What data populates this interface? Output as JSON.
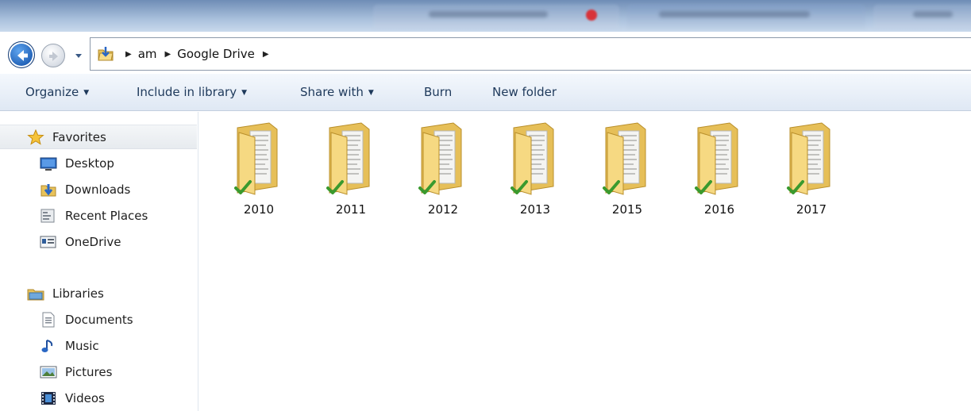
{
  "breadcrumb": {
    "items": [
      "am",
      "Google Drive"
    ]
  },
  "toolbar": {
    "organize_label": "Organize",
    "include_label": "Include in library",
    "share_label": "Share with",
    "burn_label": "Burn",
    "new_folder_label": "New folder"
  },
  "sidebar": {
    "favorites": {
      "label": "Favorites",
      "items": [
        {
          "label": "Desktop",
          "icon": "desktop-icon"
        },
        {
          "label": "Downloads",
          "icon": "downloads-icon"
        },
        {
          "label": "Recent Places",
          "icon": "recent-places-icon"
        },
        {
          "label": "OneDrive",
          "icon": "onedrive-icon"
        }
      ]
    },
    "libraries": {
      "label": "Libraries",
      "items": [
        {
          "label": "Documents",
          "icon": "documents-icon"
        },
        {
          "label": "Music",
          "icon": "music-icon"
        },
        {
          "label": "Pictures",
          "icon": "pictures-icon"
        },
        {
          "label": "Videos",
          "icon": "videos-icon"
        }
      ]
    }
  },
  "folders": [
    {
      "name": "2010",
      "sync_status": "synced"
    },
    {
      "name": "2011",
      "sync_status": "synced"
    },
    {
      "name": "2012",
      "sync_status": "synced"
    },
    {
      "name": "2013",
      "sync_status": "synced"
    },
    {
      "name": "2015",
      "sync_status": "synced"
    },
    {
      "name": "2016",
      "sync_status": "synced"
    },
    {
      "name": "2017",
      "sync_status": "synced"
    }
  ],
  "colors": {
    "accent": "#1e395b",
    "folder": "#f2d27a",
    "sync_check": "#3a9a2e",
    "selection": "#e7ebef"
  }
}
